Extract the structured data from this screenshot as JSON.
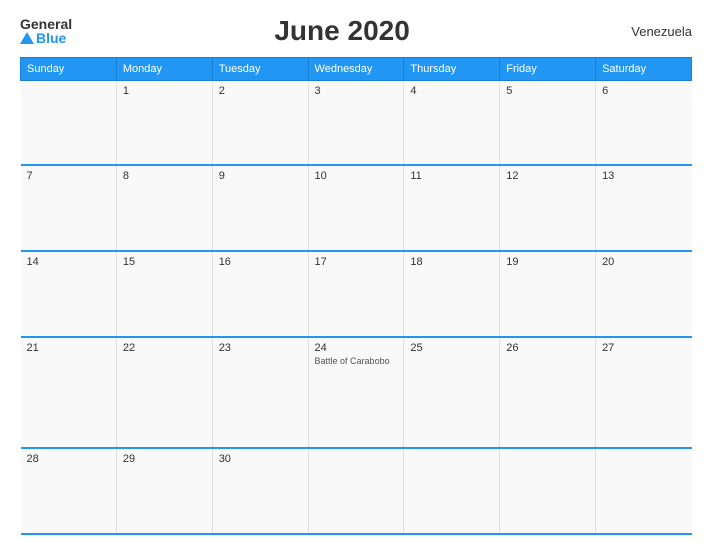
{
  "header": {
    "logo_general": "General",
    "logo_blue": "Blue",
    "title": "June 2020",
    "country": "Venezuela"
  },
  "calendar": {
    "days_of_week": [
      "Sunday",
      "Monday",
      "Tuesday",
      "Wednesday",
      "Thursday",
      "Friday",
      "Saturday"
    ],
    "weeks": [
      [
        {
          "day": "",
          "holiday": ""
        },
        {
          "day": "1",
          "holiday": ""
        },
        {
          "day": "2",
          "holiday": ""
        },
        {
          "day": "3",
          "holiday": ""
        },
        {
          "day": "4",
          "holiday": ""
        },
        {
          "day": "5",
          "holiday": ""
        },
        {
          "day": "6",
          "holiday": ""
        }
      ],
      [
        {
          "day": "7",
          "holiday": ""
        },
        {
          "day": "8",
          "holiday": ""
        },
        {
          "day": "9",
          "holiday": ""
        },
        {
          "day": "10",
          "holiday": ""
        },
        {
          "day": "11",
          "holiday": ""
        },
        {
          "day": "12",
          "holiday": ""
        },
        {
          "day": "13",
          "holiday": ""
        }
      ],
      [
        {
          "day": "14",
          "holiday": ""
        },
        {
          "day": "15",
          "holiday": ""
        },
        {
          "day": "16",
          "holiday": ""
        },
        {
          "day": "17",
          "holiday": ""
        },
        {
          "day": "18",
          "holiday": ""
        },
        {
          "day": "19",
          "holiday": ""
        },
        {
          "day": "20",
          "holiday": ""
        }
      ],
      [
        {
          "day": "21",
          "holiday": ""
        },
        {
          "day": "22",
          "holiday": ""
        },
        {
          "day": "23",
          "holiday": ""
        },
        {
          "day": "24",
          "holiday": "Battle of Carabobo"
        },
        {
          "day": "25",
          "holiday": ""
        },
        {
          "day": "26",
          "holiday": ""
        },
        {
          "day": "27",
          "holiday": ""
        }
      ],
      [
        {
          "day": "28",
          "holiday": ""
        },
        {
          "day": "29",
          "holiday": ""
        },
        {
          "day": "30",
          "holiday": ""
        },
        {
          "day": "",
          "holiday": ""
        },
        {
          "day": "",
          "holiday": ""
        },
        {
          "day": "",
          "holiday": ""
        },
        {
          "day": "",
          "holiday": ""
        }
      ]
    ]
  }
}
